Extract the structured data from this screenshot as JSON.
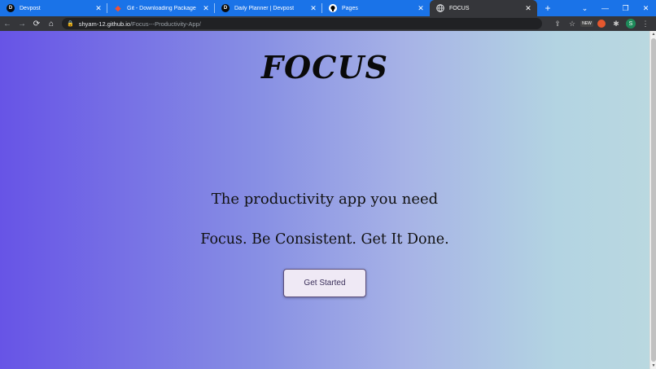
{
  "tabs": [
    {
      "title": "Devpost",
      "favicon": "devpost-icon",
      "glyph": "D"
    },
    {
      "title": "Git - Downloading Package",
      "favicon": "git-icon",
      "glyph": "◆"
    },
    {
      "title": "Daily Planner | Devpost",
      "favicon": "devpost-icon",
      "glyph": "D"
    },
    {
      "title": "Pages",
      "favicon": "github-icon",
      "glyph": "●"
    },
    {
      "title": "FOCUS",
      "favicon": "globe-icon",
      "glyph": "🌐",
      "active": true
    }
  ],
  "close_glyph": "✕",
  "new_tab_glyph": "+",
  "window_controls": {
    "dropdown": "⌄",
    "minimize": "—",
    "restore": "❐",
    "close": "✕"
  },
  "toolbar": {
    "back": "←",
    "forward": "→",
    "reload": "⟳",
    "home": "⌂",
    "lock": "🔒",
    "url_host": "shyam-12.github.io",
    "url_path": "/Focus---Productivity-App/",
    "share": "⇪",
    "star": "☆",
    "ext_new": "NEW",
    "puzzle": "✱",
    "avatar": "S",
    "menu": "⋮"
  },
  "page": {
    "logo": "FOCUS",
    "headline": "The productivity app you need",
    "tagline": "Focus. Be Consistent. Get It Done.",
    "cta_label": "Get Started"
  },
  "scrollbar": {
    "up": "▲",
    "down": "▼"
  },
  "colors": {
    "tabstrip": "#1a73e8",
    "active_tab": "#35363a",
    "gradient_start": "#6754e6",
    "gradient_end": "#bad8e0"
  }
}
